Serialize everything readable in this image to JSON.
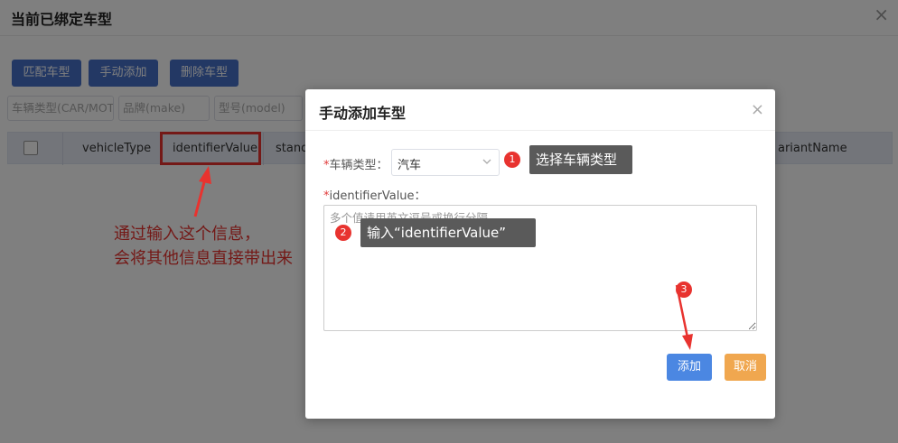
{
  "panel": {
    "title": "当前已绑定车型",
    "close_glyph": "×"
  },
  "toolbar": {
    "match_label": "匹配车型",
    "manual_add_label": "手动添加",
    "delete_label": "删除车型"
  },
  "filters": {
    "vehicle_type_placeholder": "车辆类型(CAR/MOT",
    "make_placeholder": "品牌(make)",
    "model_placeholder": "型号(model)"
  },
  "table": {
    "columns": [
      "vehicleType",
      "identifierValue",
      "stand",
      "ariantName"
    ]
  },
  "modal": {
    "title": "手动添加车型",
    "close_glyph": "×",
    "required_mark": "*",
    "type_label": "车辆类型：",
    "type_value": "汽车",
    "identifier_label": "identifierValue：",
    "identifier_placeholder": "多个值请用英文逗号或换行分隔",
    "add_label": "添加",
    "cancel_label": "取消"
  },
  "annotations": {
    "note_line1": "通过输入这个信息，",
    "note_line2": "会将其他信息直接带出来",
    "step1_num": "1",
    "step1_tip": "选择车辆类型",
    "step2_num": "2",
    "step2_tip": "输入“identifierValue”",
    "step3_num": "3"
  },
  "colors": {
    "primary_button": "#4770c8",
    "add_button": "#4b87e2",
    "cancel_button": "#f0a74f",
    "annotation_red": "#e8332f",
    "tooltip_bg": "#5a5a5a",
    "table_header_bg": "#e6ebf5"
  }
}
